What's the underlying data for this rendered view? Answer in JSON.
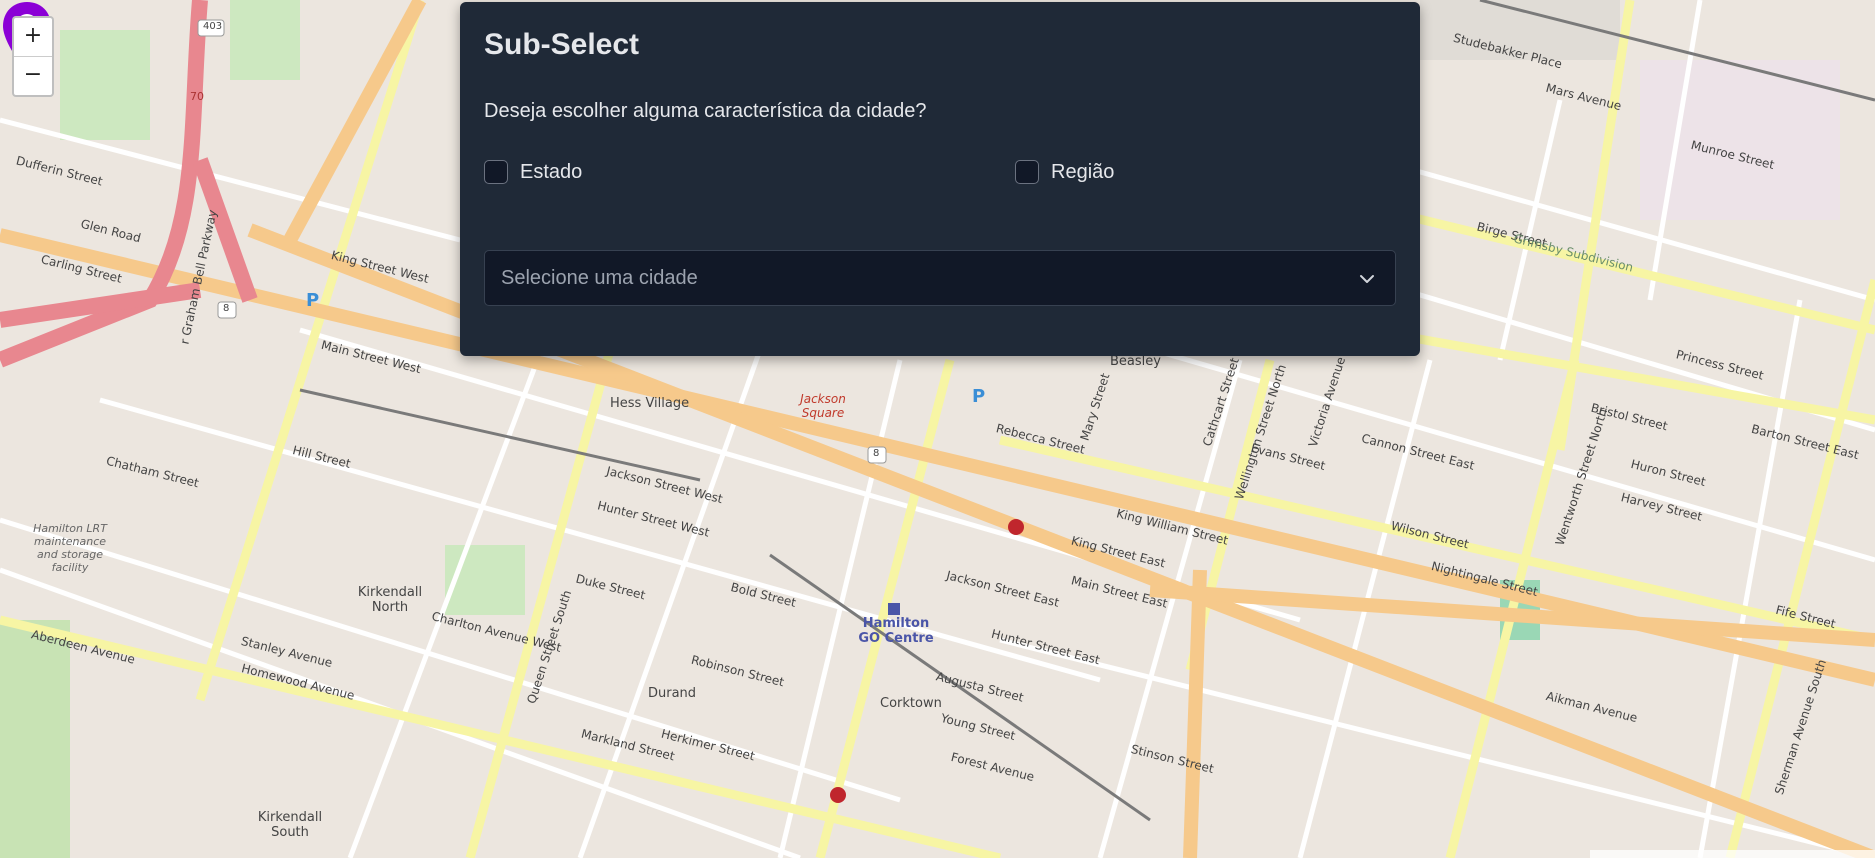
{
  "map": {
    "zoom_in": "+",
    "zoom_out": "−",
    "streets": [
      "King Street West",
      "Main Street West",
      "King Street East",
      "Main Street East",
      "Jackson Street West",
      "Jackson Street East",
      "Hunter Street West",
      "Hunter Street East",
      "Wilson Street",
      "Cannon Street East",
      "Barton Street East",
      "Aberdeen Avenue",
      "Herkimer Street",
      "Stanley Avenue",
      "Homewood Avenue",
      "Charlton Avenue West",
      "Queen Street South",
      "Young Street",
      "Stinson Street",
      "Augusta Street",
      "Forest Avenue",
      "Rebecca Street",
      "King William Street",
      "Wellington Street North",
      "Victoria Avenue",
      "Wentworth Street North",
      "Sherman Avenue South",
      "Chatham Street",
      "Hill Street",
      "Bold Street",
      "Duke Street",
      "Robinson Street",
      "Markland Street",
      "Glen Road",
      "Carling Street",
      "Dufferin Street",
      "Studebakker Place",
      "Mars Avenue",
      "Munroe Street",
      "Birge Street",
      "Grimsby Subdivision",
      "Bristol Street",
      "Huron Street",
      "Harvey Street",
      "Nightingale Street",
      "Princess Street",
      "Fife Street",
      "Aikman Avenue",
      "Mary Street",
      "Cathcart Street",
      "Evans Street"
    ],
    "places": [
      "Hess Village",
      "Kirkendall North",
      "Kirkendall South",
      "Durand",
      "Corktown",
      "Beasley",
      "Jackson Square",
      "Hamilton GO Centre",
      "Hamilton LRT maintenance and storage facility"
    ],
    "highway_label": "r Graham Bell Parkway",
    "route_shields": [
      "403",
      "8",
      "70",
      "8"
    ],
    "parking": "P",
    "marker_color": "#8b00d6"
  },
  "panel": {
    "title": "Sub-Select",
    "question": "Deseja escolher alguma característica da cidade?",
    "option_state": "Estado",
    "option_region": "Região",
    "select_placeholder": "Selecione uma cidade"
  }
}
